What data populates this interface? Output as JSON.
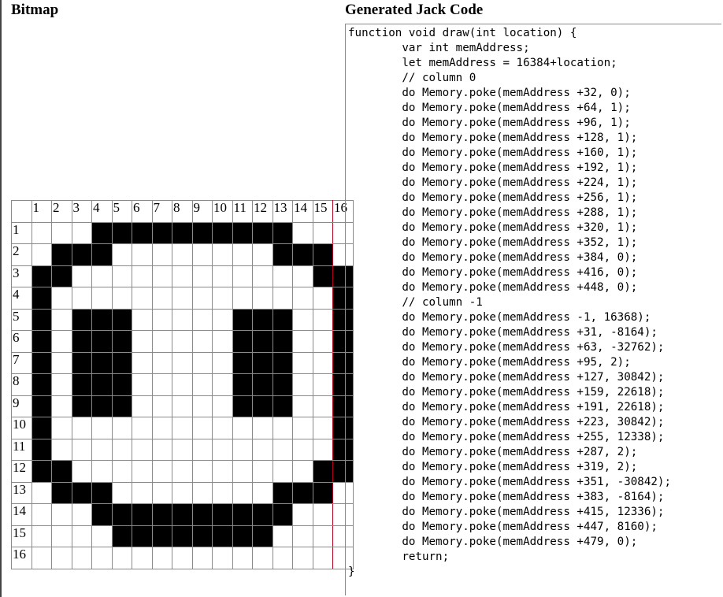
{
  "headings": {
    "bitmap": "Bitmap",
    "code": "Generated Jack Code"
  },
  "bitmap": {
    "col_headers": [
      "1",
      "2",
      "3",
      "4",
      "5",
      "6",
      "7",
      "8",
      "9",
      "10",
      "11",
      "12",
      "13",
      "14",
      "15",
      "16"
    ],
    "row_headers": [
      "1",
      "2",
      "3",
      "4",
      "5",
      "6",
      "7",
      "8",
      "9",
      "10",
      "11",
      "12",
      "13",
      "14",
      "15",
      "16"
    ],
    "rows": [
      "0001111111111000",
      "0111000000001110",
      "1100000000000011",
      "1000000000000001",
      "1011100000111001",
      "1011100000111001",
      "1011100000111001",
      "1011100000111001",
      "1011100000111001",
      "1000000000000001",
      "1000000000000001",
      "1100000000000011",
      "0111000000001110",
      "0001111111111000",
      "0000111111110000",
      "0000000000000000"
    ]
  },
  "code": {
    "lines": [
      "function void draw(int location) {",
      "        var int memAddress;",
      "        let memAddress = 16384+location;",
      "        // column 0",
      "        do Memory.poke(memAddress +32, 0);",
      "        do Memory.poke(memAddress +64, 1);",
      "        do Memory.poke(memAddress +96, 1);",
      "        do Memory.poke(memAddress +128, 1);",
      "        do Memory.poke(memAddress +160, 1);",
      "        do Memory.poke(memAddress +192, 1);",
      "        do Memory.poke(memAddress +224, 1);",
      "        do Memory.poke(memAddress +256, 1);",
      "        do Memory.poke(memAddress +288, 1);",
      "        do Memory.poke(memAddress +320, 1);",
      "        do Memory.poke(memAddress +352, 1);",
      "        do Memory.poke(memAddress +384, 0);",
      "        do Memory.poke(memAddress +416, 0);",
      "        do Memory.poke(memAddress +448, 0);",
      "        // column -1",
      "        do Memory.poke(memAddress -1, 16368);",
      "        do Memory.poke(memAddress +31, -8164);",
      "        do Memory.poke(memAddress +63, -32762);",
      "        do Memory.poke(memAddress +95, 2);",
      "        do Memory.poke(memAddress +127, 30842);",
      "        do Memory.poke(memAddress +159, 22618);",
      "        do Memory.poke(memAddress +191, 22618);",
      "        do Memory.poke(memAddress +223, 30842);",
      "        do Memory.poke(memAddress +255, 12338);",
      "        do Memory.poke(memAddress +287, 2);",
      "        do Memory.poke(memAddress +319, 2);",
      "        do Memory.poke(memAddress +351, -30842);",
      "        do Memory.poke(memAddress +383, -8164);",
      "        do Memory.poke(memAddress +415, 12336);",
      "        do Memory.poke(memAddress +447, 8160);",
      "        do Memory.poke(memAddress +479, 0);",
      "        return;",
      "}"
    ]
  },
  "colors": {
    "cell_on": "#000000",
    "cell_off": "#ffffff",
    "grid": "#8a8a8a",
    "column16_border": "#b00020"
  }
}
